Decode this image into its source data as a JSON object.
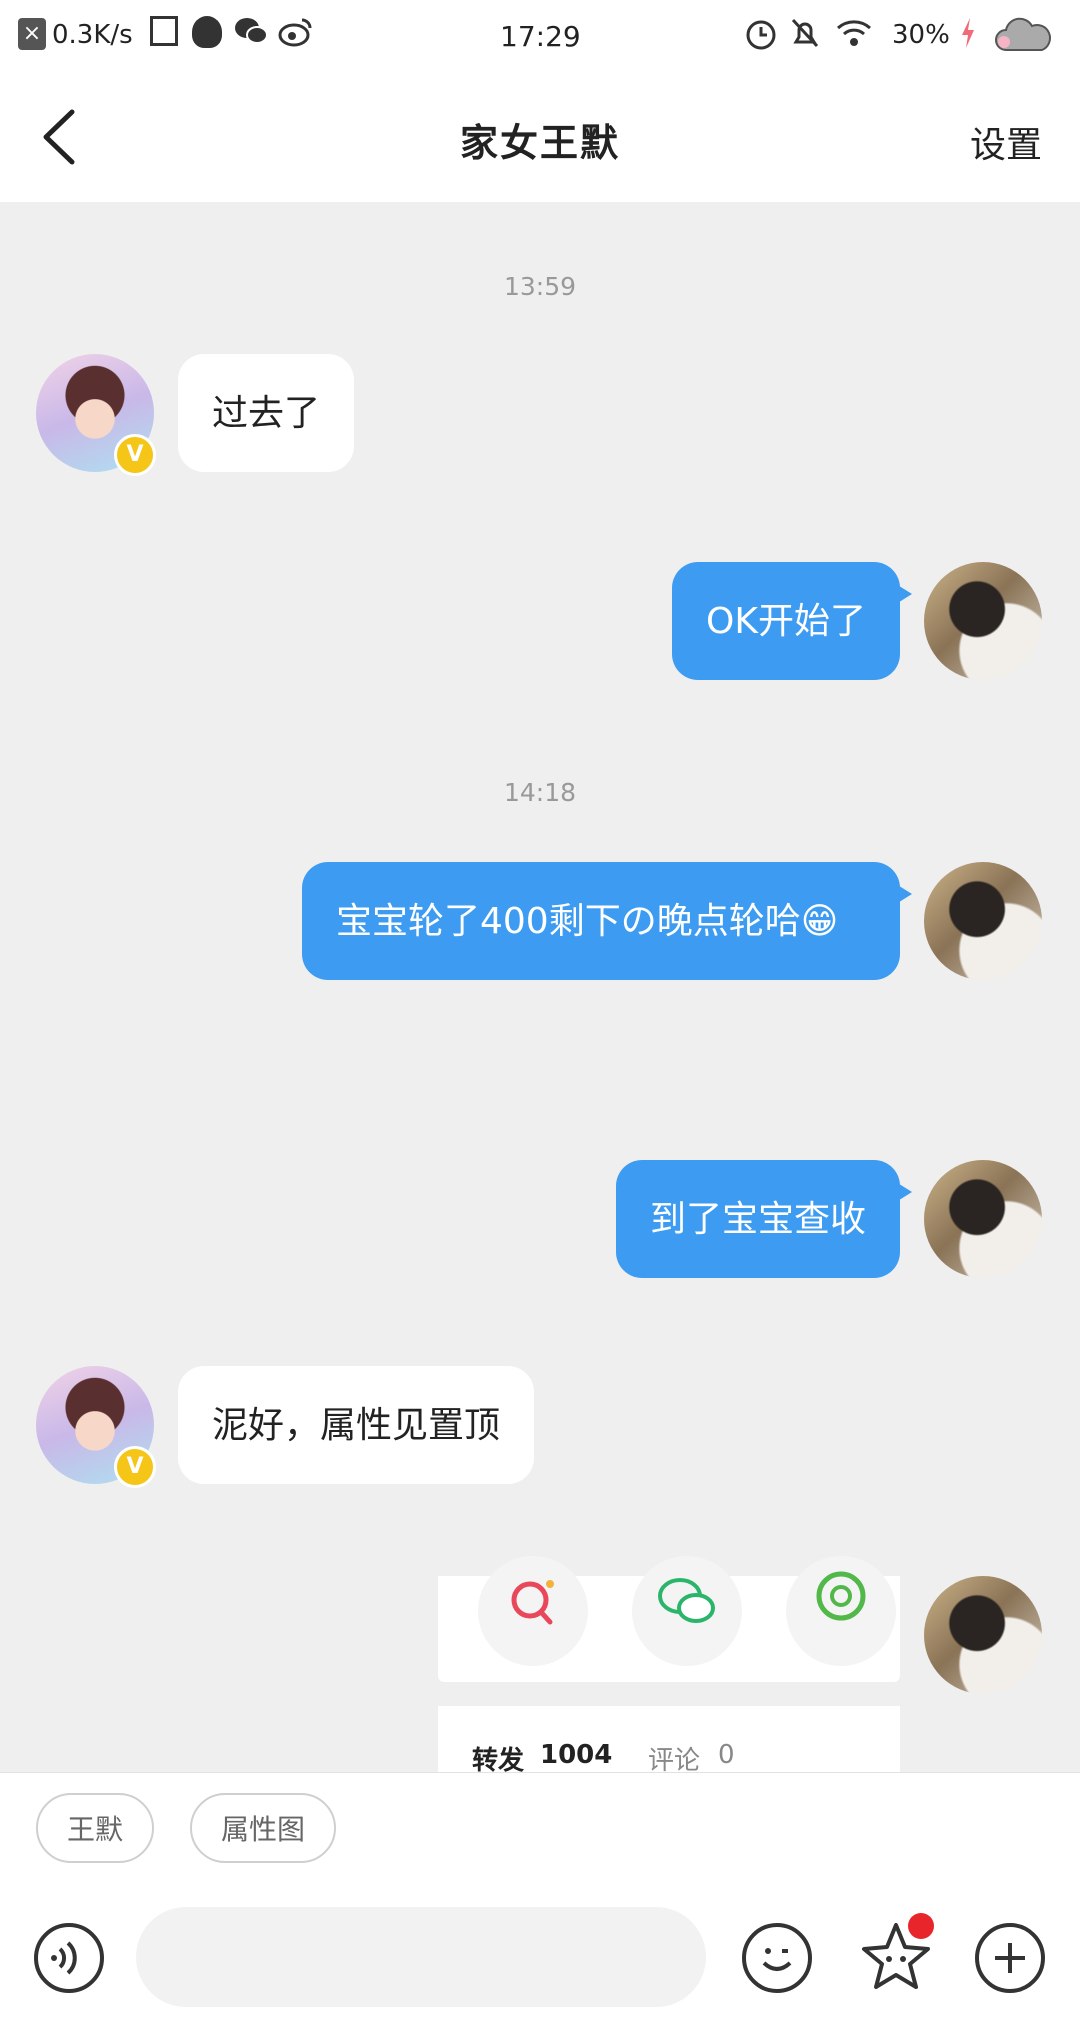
{
  "status_bar": {
    "net_speed": "0.3K/s",
    "time": "17:29",
    "battery": "30%"
  },
  "header": {
    "title": "家女王默",
    "settings_label": "设置"
  },
  "messages": {
    "ts1": "13:59",
    "m1": "过去了",
    "m2": "OK开始了",
    "ts2": "14:18",
    "m3": "宝宝轮了400剩下の晚点轮哈😁",
    "m4": "到了宝宝查收",
    "m5": "泥好，属性见置顶"
  },
  "shared_card": {
    "forward_label": "转发",
    "forward_count": "1004",
    "comment_label": "评论",
    "comment_count": "0"
  },
  "quick_replies": [
    "王默",
    "属性图"
  ],
  "icons": {
    "back": "back-arrow-icon",
    "voice": "voice-icon",
    "emoji": "emoji-icon",
    "star": "star-sticker-icon",
    "plus": "plus-icon"
  },
  "colors": {
    "accent": "#3d9cf2",
    "chat_bg": "#efefef",
    "badge": "#f5c518",
    "notify_dot": "#e8252a"
  }
}
